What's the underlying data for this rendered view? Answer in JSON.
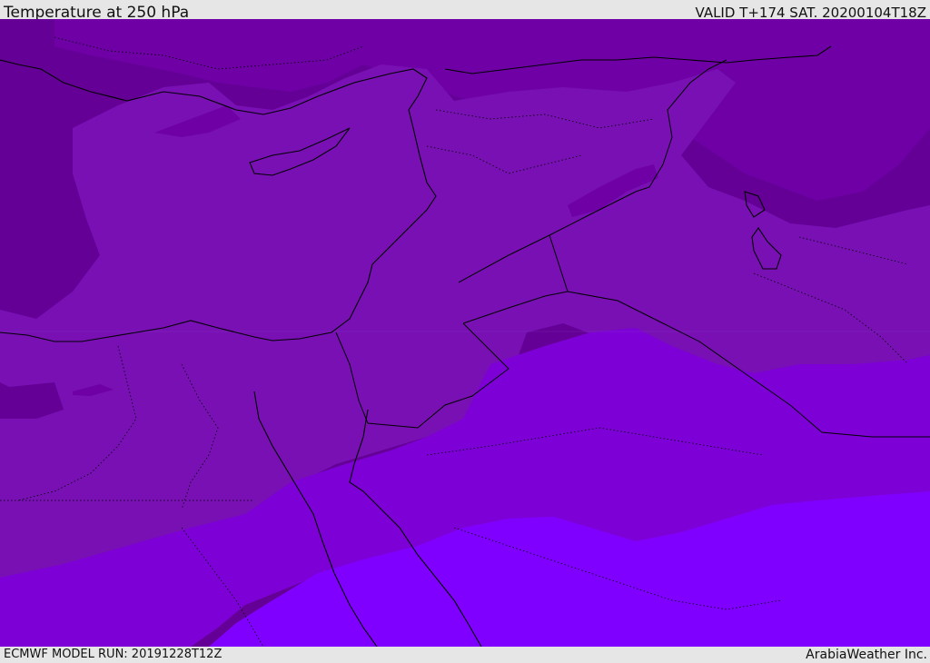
{
  "header": {
    "title": "Temperature at 250 hPa",
    "valid_time": "VALID T+174 SAT. 20200104T18Z"
  },
  "footer": {
    "model_run": "ECMWF MODEL RUN: 20191228T12Z",
    "credit": "ArabiaWeather Inc."
  },
  "map": {
    "field": "temperature",
    "level": "250 hPa",
    "colors": {
      "band_darkest": "#640096",
      "band_dark": "#6e00a6",
      "band_mid": "#7810b4",
      "band_violet": "#7d00d7",
      "band_bright": "#8000ff",
      "coastline": "#000000"
    }
  }
}
